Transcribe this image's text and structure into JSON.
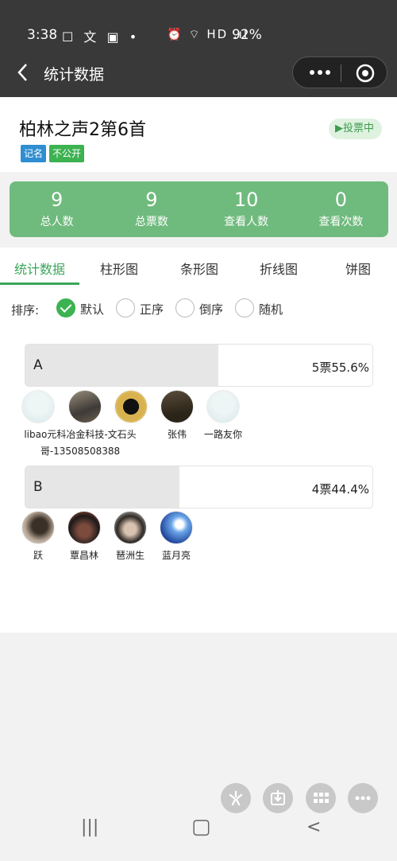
{
  "status_bar": {
    "time": "3:38",
    "notification_icons": "☐ 文 ▣ •",
    "system_icons": "⏰ ⌔ HD .ıl",
    "battery": "92%"
  },
  "navbar": {
    "title": "统计数据"
  },
  "vote": {
    "title": "柏林之声2第6首",
    "status": "▶投票中",
    "tags": [
      "记名",
      "不公开"
    ]
  },
  "stats": [
    {
      "value": "9",
      "label": "总人数"
    },
    {
      "value": "9",
      "label": "总票数"
    },
    {
      "value": "10",
      "label": "查看人数"
    },
    {
      "value": "0",
      "label": "查看次数"
    }
  ],
  "tabs": [
    "统计数据",
    "柱形图",
    "条形图",
    "折线图",
    "饼图"
  ],
  "active_tab": "统计数据",
  "sort": {
    "label": "排序:",
    "options": [
      "默认",
      "正序",
      "倒序",
      "随机"
    ],
    "selected": "默认"
  },
  "options": [
    {
      "name": "A",
      "result": "5票55.6%",
      "share": 0.556,
      "voters": [
        {
          "name": ""
        },
        {
          "name": "libao元科冶金科技-文石头哥-13508508388"
        },
        {
          "name": ""
        },
        {
          "name": "张伟"
        },
        {
          "name": "一路友你"
        }
      ]
    },
    {
      "name": "B",
      "result": "4票44.4%",
      "share": 0.444,
      "voters": [
        {
          "name": "跃"
        },
        {
          "name": "覃昌林"
        },
        {
          "name": "琶洲生"
        },
        {
          "name": "蓝月亮"
        }
      ]
    }
  ],
  "fab_icons": [
    "sparkle-icon",
    "download-icon",
    "grid-icon",
    "more-icon"
  ],
  "system_nav": [
    "|||",
    "▢",
    "<"
  ],
  "colors": {
    "accent": "#3aa65a",
    "stats_bg": "#6fba7d",
    "navbar": "#393939"
  }
}
